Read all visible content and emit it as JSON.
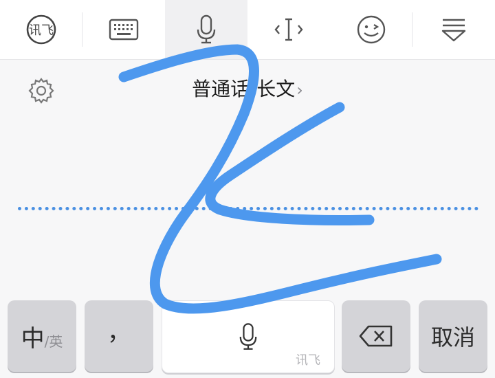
{
  "toolbar": {
    "items": [
      {
        "icon": "ifly-logo-icon",
        "label": "讯飞"
      },
      {
        "icon": "keyboard-icon"
      },
      {
        "icon": "mic-icon",
        "active": true
      },
      {
        "icon": "text-cursor-icon"
      },
      {
        "icon": "emoji-icon"
      },
      {
        "icon": "hide-keyboard-icon"
      }
    ]
  },
  "voice": {
    "mode_label": "普通话-长文",
    "chevron": "›"
  },
  "keys": {
    "lang_main": "中",
    "lang_sub": "/英",
    "comma": "，",
    "brand": "讯飞",
    "cancel": "取消"
  },
  "colors": {
    "accent": "#4a90e2",
    "stroke": "#4d98ee"
  }
}
